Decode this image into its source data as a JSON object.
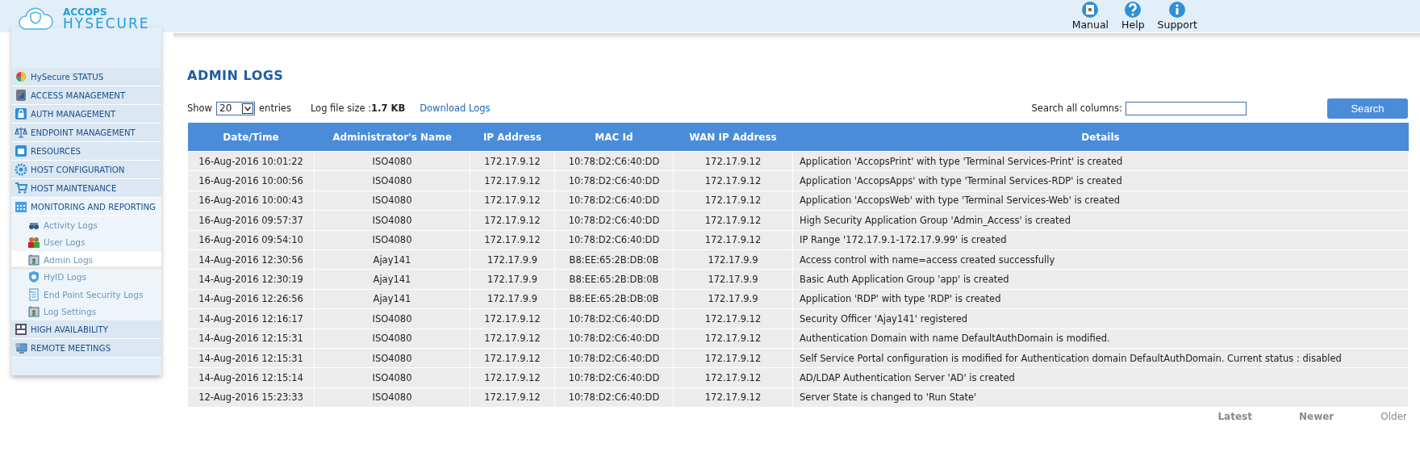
{
  "header": {
    "brand_top": "ACCOPS",
    "brand_bottom": "HYSECURE",
    "links": [
      {
        "label": "Manual"
      },
      {
        "label": "Help"
      },
      {
        "label": "Support"
      }
    ]
  },
  "sidebar": {
    "items": [
      {
        "label": "HySecure STATUS",
        "expanded": false
      },
      {
        "label": "ACCESS MANAGEMENT",
        "expanded": false
      },
      {
        "label": "AUTH MANAGEMENT",
        "expanded": false
      },
      {
        "label": "ENDPOINT MANAGEMENT",
        "expanded": false
      },
      {
        "label": "RESOURCES",
        "expanded": false
      },
      {
        "label": "HOST CONFIGURATION",
        "expanded": false
      },
      {
        "label": "HOST MAINTENANCE",
        "expanded": false
      },
      {
        "label": "MONITORING AND REPORTING",
        "expanded": true,
        "children": [
          {
            "label": "Activity Logs",
            "selected": false
          },
          {
            "label": "User Logs",
            "selected": false
          },
          {
            "label": "Admin Logs",
            "selected": true
          },
          {
            "label": "HyID Logs",
            "selected": false
          },
          {
            "label": "End Point Security Logs",
            "selected": false
          },
          {
            "label": "Log Settings",
            "selected": false
          }
        ]
      },
      {
        "label": "HIGH AVAILABILITY",
        "expanded": false
      },
      {
        "label": "REMOTE MEETINGS",
        "expanded": false
      }
    ]
  },
  "page_title": "ADMIN LOGS",
  "toolbar": {
    "show_label": "Show",
    "entries_value": "20",
    "entries_label": "entries",
    "log_size_label": "Log file size :",
    "log_size_value": "1.7 KB",
    "download_link": "Download Logs",
    "search_label": "Search all columns:",
    "search_button": "Search"
  },
  "table": {
    "columns": [
      "Date/Time",
      "Administrator's Name",
      "IP Address",
      "MAC Id",
      "WAN IP Address",
      "Details"
    ],
    "rows": [
      [
        "16-Aug-2016 10:01:22",
        "ISO4080",
        "172.17.9.12",
        "10:78:D2:C6:40:DD",
        "172.17.9.12",
        "Application 'AccopsPrint' with type 'Terminal Services-Print' is created"
      ],
      [
        "16-Aug-2016 10:00:56",
        "ISO4080",
        "172.17.9.12",
        "10:78:D2:C6:40:DD",
        "172.17.9.12",
        "Application 'AccopsApps' with type 'Terminal Services-RDP' is created"
      ],
      [
        "16-Aug-2016 10:00:43",
        "ISO4080",
        "172.17.9.12",
        "10:78:D2:C6:40:DD",
        "172.17.9.12",
        "Application 'AccopsWeb' with type 'Terminal Services-Web' is created"
      ],
      [
        "16-Aug-2016 09:57:37",
        "ISO4080",
        "172.17.9.12",
        "10:78:D2:C6:40:DD",
        "172.17.9.12",
        "High Security Application Group 'Admin_Access' is created"
      ],
      [
        "16-Aug-2016 09:54:10",
        "ISO4080",
        "172.17.9.12",
        "10:78:D2:C6:40:DD",
        "172.17.9.12",
        "IP Range '172.17.9.1-172.17.9.99' is created"
      ],
      [
        "14-Aug-2016 12:30:56",
        "Ajay141",
        "172.17.9.9",
        "B8:EE:65:2B:DB:0B",
        "172.17.9.9",
        "Access control with name=access created successfully"
      ],
      [
        "14-Aug-2016 12:30:19",
        "Ajay141",
        "172.17.9.9",
        "B8:EE:65:2B:DB:0B",
        "172.17.9.9",
        "Basic Auth Application Group 'app' is created"
      ],
      [
        "14-Aug-2016 12:26:56",
        "Ajay141",
        "172.17.9.9",
        "B8:EE:65:2B:DB:0B",
        "172.17.9.9",
        "Application 'RDP' with type 'RDP' is created"
      ],
      [
        "14-Aug-2016 12:16:17",
        "ISO4080",
        "172.17.9.12",
        "10:78:D2:C6:40:DD",
        "172.17.9.12",
        "Security Officer 'Ajay141' registered"
      ],
      [
        "14-Aug-2016 12:15:31",
        "ISO4080",
        "172.17.9.12",
        "10:78:D2:C6:40:DD",
        "172.17.9.12",
        "Authentication Domain with name DefaultAuthDomain is modified."
      ],
      [
        "14-Aug-2016 12:15:31",
        "ISO4080",
        "172.17.9.12",
        "10:78:D2:C6:40:DD",
        "172.17.9.12",
        "Self Service Portal configuration is modified for Authentication domain DefaultAuthDomain. Current status : disabled"
      ],
      [
        "14-Aug-2016 12:15:14",
        "ISO4080",
        "172.17.9.12",
        "10:78:D2:C6:40:DD",
        "172.17.9.12",
        "AD/LDAP Authentication Server 'AD' is created"
      ],
      [
        "12-Aug-2016 15:23:33",
        "ISO4080",
        "172.17.9.12",
        "10:78:D2:C6:40:DD",
        "172.17.9.12",
        "Server State is changed to 'Run State'"
      ]
    ]
  },
  "pager": [
    {
      "label": "Latest",
      "disabled": true
    },
    {
      "label": "Newer",
      "disabled": true
    },
    {
      "label": "Older",
      "disabled": false
    }
  ]
}
